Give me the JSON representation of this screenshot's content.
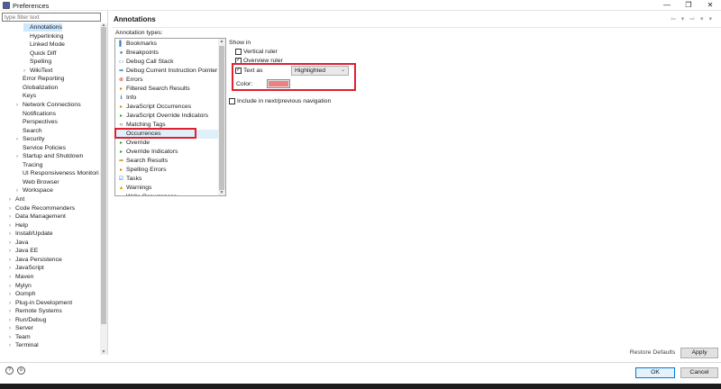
{
  "window": {
    "title": "Preferences",
    "minimize_glyph": "—",
    "restore_glyph": "❐",
    "close_glyph": "✕"
  },
  "filter": {
    "placeholder": "type filter text"
  },
  "tree": [
    {
      "label": "Annotations",
      "indent": 3,
      "arrow": "",
      "selected": true
    },
    {
      "label": "Hyperlinking",
      "indent": 3,
      "arrow": ""
    },
    {
      "label": "Linked Mode",
      "indent": 3,
      "arrow": ""
    },
    {
      "label": "Quick Diff",
      "indent": 3,
      "arrow": ""
    },
    {
      "label": "Spelling",
      "indent": 3,
      "arrow": ""
    },
    {
      "label": "WikiText",
      "indent": 3,
      "arrow": "›"
    },
    {
      "label": "Error Reporting",
      "indent": 2,
      "arrow": ""
    },
    {
      "label": "Globalization",
      "indent": 2,
      "arrow": ""
    },
    {
      "label": "Keys",
      "indent": 2,
      "arrow": ""
    },
    {
      "label": "Network Connections",
      "indent": 2,
      "arrow": "›"
    },
    {
      "label": "Notifications",
      "indent": 2,
      "arrow": ""
    },
    {
      "label": "Perspectives",
      "indent": 2,
      "arrow": ""
    },
    {
      "label": "Search",
      "indent": 2,
      "arrow": ""
    },
    {
      "label": "Security",
      "indent": 2,
      "arrow": "›"
    },
    {
      "label": "Service Policies",
      "indent": 2,
      "arrow": ""
    },
    {
      "label": "Startup and Shutdown",
      "indent": 2,
      "arrow": "›"
    },
    {
      "label": "Tracing",
      "indent": 2,
      "arrow": ""
    },
    {
      "label": "UI Responsiveness Monitorin",
      "indent": 2,
      "arrow": ""
    },
    {
      "label": "Web Browser",
      "indent": 2,
      "arrow": ""
    },
    {
      "label": "Workspace",
      "indent": 2,
      "arrow": "›"
    },
    {
      "label": "Ant",
      "indent": 1,
      "arrow": "›"
    },
    {
      "label": "Code Recommenders",
      "indent": 1,
      "arrow": "›"
    },
    {
      "label": "Data Management",
      "indent": 1,
      "arrow": "›"
    },
    {
      "label": "Help",
      "indent": 1,
      "arrow": "›"
    },
    {
      "label": "Install/Update",
      "indent": 1,
      "arrow": "›"
    },
    {
      "label": "Java",
      "indent": 1,
      "arrow": "›"
    },
    {
      "label": "Java EE",
      "indent": 1,
      "arrow": "›"
    },
    {
      "label": "Java Persistence",
      "indent": 1,
      "arrow": "›"
    },
    {
      "label": "JavaScript",
      "indent": 1,
      "arrow": "›"
    },
    {
      "label": "Maven",
      "indent": 1,
      "arrow": "›"
    },
    {
      "label": "Mylyn",
      "indent": 1,
      "arrow": "›"
    },
    {
      "label": "Oomph",
      "indent": 1,
      "arrow": "›"
    },
    {
      "label": "Plug-in Development",
      "indent": 1,
      "arrow": "›"
    },
    {
      "label": "Remote Systems",
      "indent": 1,
      "arrow": "›"
    },
    {
      "label": "Run/Debug",
      "indent": 1,
      "arrow": "›"
    },
    {
      "label": "Server",
      "indent": 1,
      "arrow": "›"
    },
    {
      "label": "Team",
      "indent": 1,
      "arrow": "›"
    },
    {
      "label": "Terminal",
      "indent": 1,
      "arrow": "›"
    }
  ],
  "page": {
    "title": "Annotations",
    "nav_glyphs": "⇦ ▾ ⇨ ▾ ▾"
  },
  "annotation_types": {
    "label": "Annotation types:",
    "items": [
      {
        "label": "Bookmarks",
        "icon": "bookmark-icon",
        "glyph": "▌",
        "color": "#3a78c3"
      },
      {
        "label": "Breakpoints",
        "icon": "breakpoint-icon",
        "glyph": "●",
        "color": "#3a78c3"
      },
      {
        "label": "Debug Call Stack",
        "icon": "stack-icon",
        "glyph": "▭",
        "color": "#7d8fa8"
      },
      {
        "label": "Debug Current Instruction Pointer",
        "icon": "pointer-icon",
        "glyph": "➡",
        "color": "#3a78c3"
      },
      {
        "label": "Errors",
        "icon": "error-icon",
        "glyph": "⊗",
        "color": "#d93025"
      },
      {
        "label": "Filtered Search Results",
        "icon": "filter-icon",
        "glyph": "▸",
        "color": "#c98a1a"
      },
      {
        "label": "Info",
        "icon": "info-icon",
        "glyph": "ℹ",
        "color": "#3a78c3"
      },
      {
        "label": "JavaScript Occurrences",
        "icon": "js-icon",
        "glyph": "▸",
        "color": "#c98a1a"
      },
      {
        "label": "JavaScript Override Indicators",
        "icon": "js-override-icon",
        "glyph": "▸",
        "color": "#3a9a3a"
      },
      {
        "label": "Matching Tags",
        "icon": "tags-icon",
        "glyph": "‹›",
        "color": "#555555"
      },
      {
        "label": "Occurrences",
        "icon": "occurrences-icon",
        "glyph": "",
        "color": "#555555",
        "selected": true
      },
      {
        "label": "Override",
        "icon": "override-icon",
        "glyph": "▸",
        "color": "#3a9a3a"
      },
      {
        "label": "Override Indicators",
        "icon": "override-indicator-icon",
        "glyph": "▸",
        "color": "#3a9a3a"
      },
      {
        "label": "Search Results",
        "icon": "search-results-icon",
        "glyph": "➡",
        "color": "#c98a1a"
      },
      {
        "label": "Spelling Errors",
        "icon": "spelling-icon",
        "glyph": "▸",
        "color": "#c98a1a"
      },
      {
        "label": "Tasks",
        "icon": "task-icon",
        "glyph": "☑",
        "color": "#3a78c3"
      },
      {
        "label": "Warnings",
        "icon": "warning-icon",
        "glyph": "▲",
        "color": "#e0a800"
      },
      {
        "label": "Write Occurrences",
        "icon": "write-icon",
        "glyph": "▸",
        "color": "#c98a1a"
      }
    ]
  },
  "options": {
    "show_in_label": "Show in",
    "vertical_ruler": {
      "label": "Vertical ruler",
      "checked": false
    },
    "overview_ruler": {
      "label": "Overview ruler",
      "checked": true
    },
    "text_as": {
      "label": "Text as",
      "checked": true,
      "value": "Highlighted"
    },
    "color": {
      "label": "Color:",
      "swatch": "#f08080"
    },
    "include_nav": {
      "label": "Include in next/previous navigation",
      "checked": false
    }
  },
  "buttons": {
    "restore_defaults": "Restore Defaults",
    "apply": "Apply",
    "ok": "OK",
    "cancel": "Cancel",
    "help_glyph": "?",
    "import_glyph": "⊙"
  },
  "highlight_color": "#e0202f",
  "selection_color": "#cce8ff"
}
